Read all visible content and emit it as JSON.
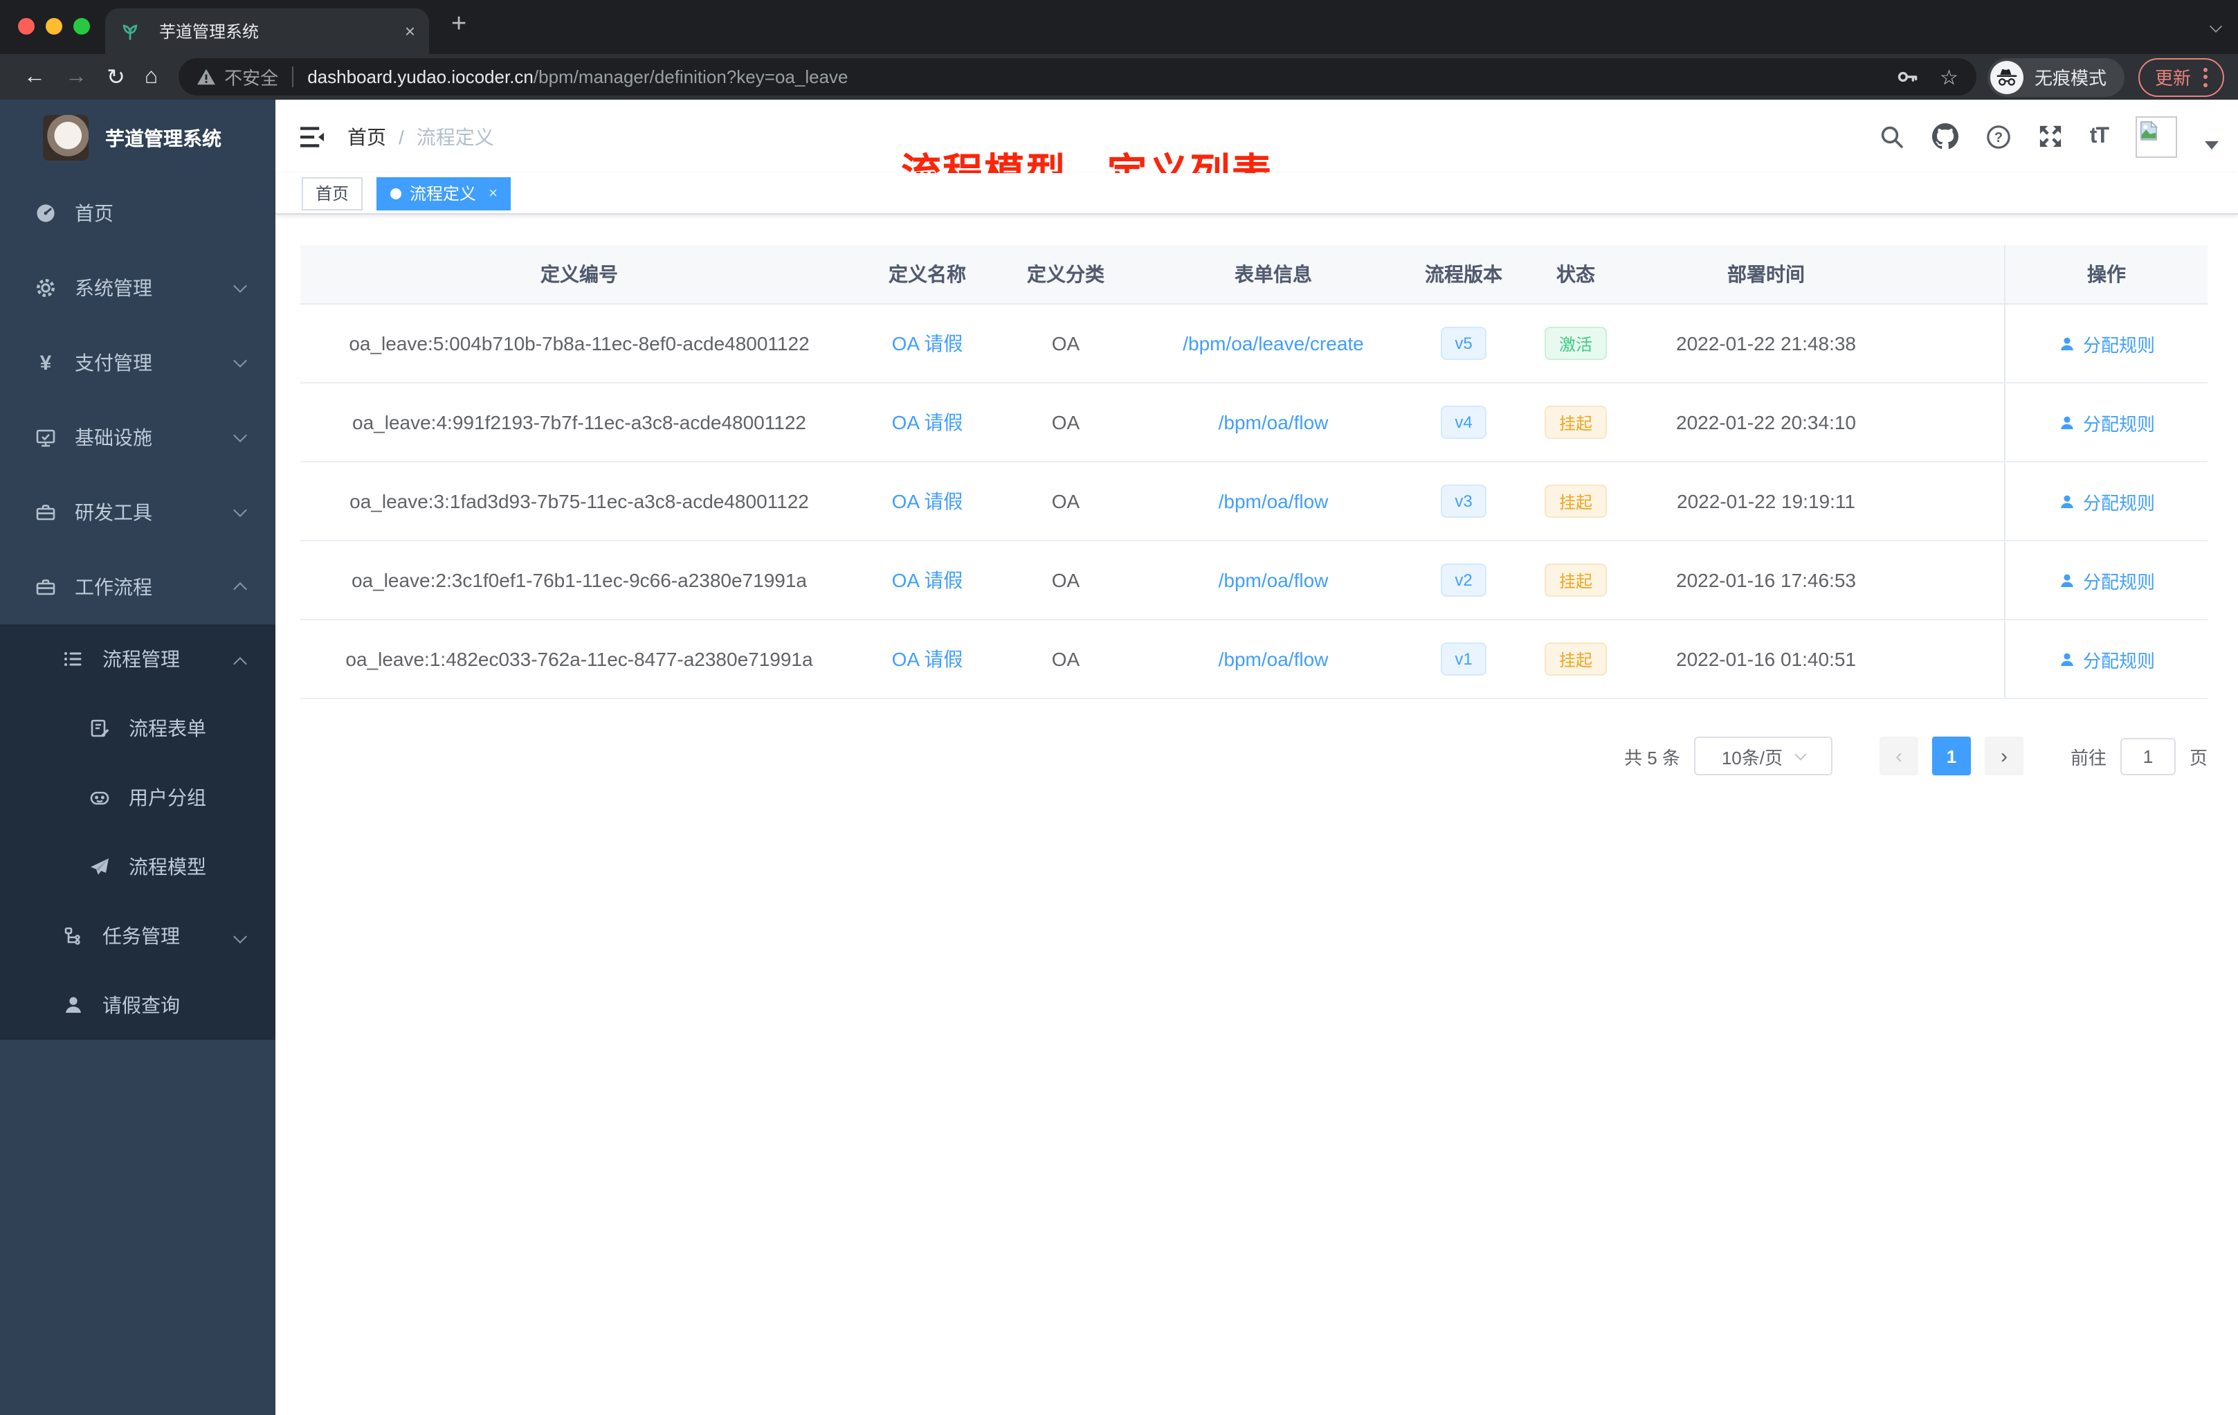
{
  "browser": {
    "tab_title": "芋道管理系统",
    "close_glyph": "×",
    "new_tab_glyph": "+",
    "back_glyph": "←",
    "forward_glyph": "→",
    "reload_glyph": "↻",
    "home_glyph": "⌂",
    "security_label": "不安全",
    "url_host": "dashboard.yudao.iocoder.cn",
    "url_path": "/bpm/manager/definition?key=oa_leave",
    "star_glyph": "☆",
    "incognito_label": "无痕模式",
    "update_label": "更新"
  },
  "sidebar": {
    "logo_title": "芋道管理系统",
    "items": [
      {
        "label": "首页"
      },
      {
        "label": "系统管理"
      },
      {
        "label": "支付管理"
      },
      {
        "label": "基础设施"
      },
      {
        "label": "研发工具"
      },
      {
        "label": "工作流程"
      },
      {
        "label": "流程管理"
      },
      {
        "label": "流程表单"
      },
      {
        "label": "用户分组"
      },
      {
        "label": "流程模型"
      },
      {
        "label": "任务管理"
      },
      {
        "label": "请假查询"
      }
    ]
  },
  "header": {
    "breadcrumb_home": "首页",
    "breadcrumb_sep": "/",
    "breadcrumb_current": "流程定义",
    "overlay_title": "流程模型 - 定义列表",
    "font_icon_label": "tT"
  },
  "tags": {
    "home": "首页",
    "current": "流程定义",
    "close_glyph": "×"
  },
  "table": {
    "columns": [
      "定义编号",
      "定义名称",
      "定义分类",
      "表单信息",
      "流程版本",
      "状态",
      "部署时间",
      "操作"
    ],
    "action_label": "分配规则",
    "rows": [
      {
        "id": "oa_leave:5:004b710b-7b8a-11ec-8ef0-acde48001122",
        "name": "OA 请假",
        "category": "OA",
        "form": "/bpm/oa/leave/create",
        "version": "v5",
        "status": "激活",
        "time": "2022-01-22 21:48:38"
      },
      {
        "id": "oa_leave:4:991f2193-7b7f-11ec-a3c8-acde48001122",
        "name": "OA 请假",
        "category": "OA",
        "form": "/bpm/oa/flow",
        "version": "v4",
        "status": "挂起",
        "time": "2022-01-22 20:34:10"
      },
      {
        "id": "oa_leave:3:1fad3d93-7b75-11ec-a3c8-acde48001122",
        "name": "OA 请假",
        "category": "OA",
        "form": "/bpm/oa/flow",
        "version": "v3",
        "status": "挂起",
        "time": "2022-01-22 19:19:11"
      },
      {
        "id": "oa_leave:2:3c1f0ef1-76b1-11ec-9c66-a2380e71991a",
        "name": "OA 请假",
        "category": "OA",
        "form": "/bpm/oa/flow",
        "version": "v2",
        "status": "挂起",
        "time": "2022-01-16 17:46:53"
      },
      {
        "id": "oa_leave:1:482ec033-762a-11ec-8477-a2380e71991a",
        "name": "OA 请假",
        "category": "OA",
        "form": "/bpm/oa/flow",
        "version": "v1",
        "status": "挂起",
        "time": "2022-01-16 01:40:51"
      }
    ]
  },
  "pagination": {
    "total": "共 5 条",
    "page_size": "10条/页",
    "prev_glyph": "‹",
    "current": "1",
    "next_glyph": "›",
    "goto_label": "前往",
    "goto_value": "1",
    "unit": "页"
  },
  "colors": {
    "primary": "#409eff",
    "sidebar_bg": "#304156",
    "submenu_bg": "#1f2d3d",
    "annotation_red": "#f9260b",
    "success_text": "#3bcc83",
    "warning_text": "#efa622",
    "link": "#409eff"
  }
}
